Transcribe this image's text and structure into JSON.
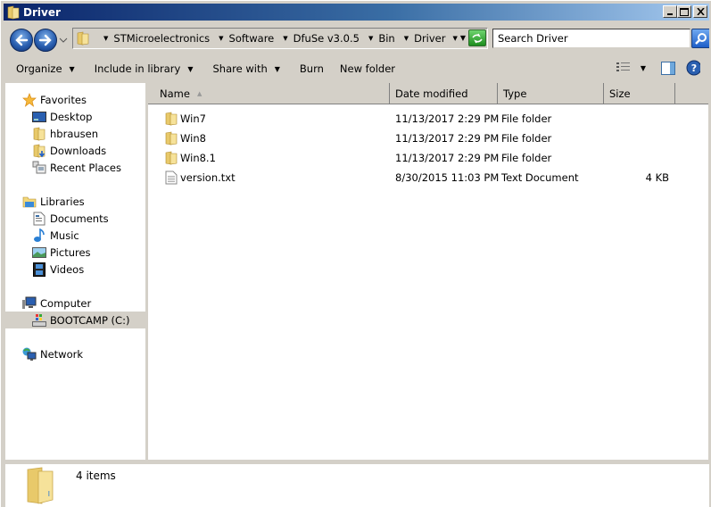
{
  "window": {
    "title": "Driver",
    "buttons": {
      "minimize": "_",
      "maximize": "□",
      "close": "×"
    }
  },
  "address": {
    "breadcrumbs": [
      "STMicroelectronics",
      "Software",
      "DfuSe v3.0.5",
      "Bin",
      "Driver"
    ],
    "search_placeholder": "Search Driver"
  },
  "toolbar": {
    "organize": "Organize",
    "include_in_library": "Include in library",
    "share_with": "Share with",
    "burn": "Burn",
    "new_folder": "New folder"
  },
  "nav": {
    "favorites": {
      "label": "Favorites",
      "items": [
        "Desktop",
        "hbrausen",
        "Downloads",
        "Recent Places"
      ]
    },
    "libraries": {
      "label": "Libraries",
      "items": [
        "Documents",
        "Music",
        "Pictures",
        "Videos"
      ]
    },
    "computer": {
      "label": "Computer",
      "items": [
        "BOOTCAMP (C:)"
      ],
      "selected": "BOOTCAMP (C:)"
    },
    "network": {
      "label": "Network"
    }
  },
  "columns": [
    "Name",
    "Date modified",
    "Type",
    "Size"
  ],
  "files": [
    {
      "name": "Win7",
      "date": "11/13/2017 2:29 PM",
      "type": "File folder",
      "size": "",
      "icon": "folder"
    },
    {
      "name": "Win8",
      "date": "11/13/2017 2:29 PM",
      "type": "File folder",
      "size": "",
      "icon": "folder"
    },
    {
      "name": "Win8.1",
      "date": "11/13/2017 2:29 PM",
      "type": "File folder",
      "size": "",
      "icon": "folder"
    },
    {
      "name": "version.txt",
      "date": "8/30/2015 11:03 PM",
      "type": "Text Document",
      "size": "4 KB",
      "icon": "text-file"
    }
  ],
  "status": {
    "item_count": "4 items"
  },
  "colors": {
    "title_gradient_start": "#0a246a",
    "title_gradient_end": "#a6caf0",
    "chrome": "#d4d0c8",
    "selection": "#d4d0c8"
  }
}
